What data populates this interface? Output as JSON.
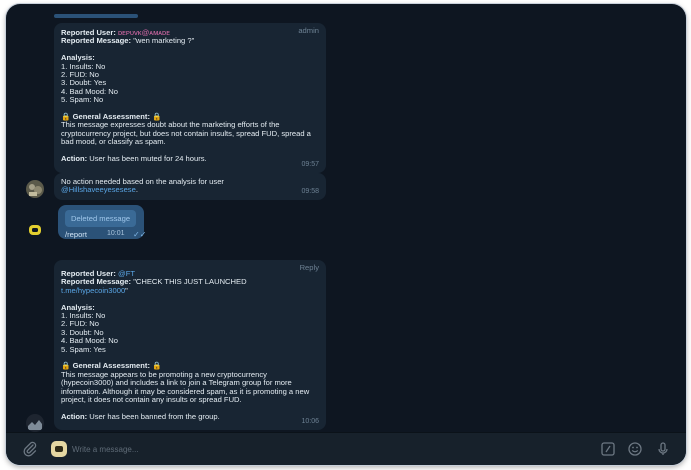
{
  "colors": {
    "background": "#0e1621",
    "bubble_in": "#182533",
    "bubble_out": "#2b5278",
    "link": "#5aa6e6",
    "time": "#6d8193"
  },
  "messages": {
    "m1": {
      "role": "admin",
      "reported_user_label": "Reported User:",
      "reported_user_value": "ᴅᴇᴩᴜᴠᴋ@ᴀᴍᴀᴅᴇ",
      "reported_message_label": "Reported Message:",
      "reported_message_value": "\"wen marketing ?\"",
      "analysis_label": "Analysis:",
      "analysis": [
        "1. Insults: No",
        "2. FUD: No",
        "3. Doubt: Yes",
        "4. Bad Mood: No",
        "5. Spam: No"
      ],
      "assessment_title": "General Assessment:",
      "assessment_text": "This message expresses doubt about the marketing efforts of the cryptocurrency project, but does not contain insults, spread FUD, spread a bad mood, or classify as spam.",
      "action_label": "Action:",
      "action_text": "User has been muted for 24 hours.",
      "time": "09:57"
    },
    "m2": {
      "text": "No action needed based on the analysis for user",
      "mention": "@Hillshaveeyesesese",
      "suffix": ".",
      "time": "09:58"
    },
    "m3": {
      "deleted_label": "Deleted message",
      "command": "/report",
      "time": "10:01",
      "check_icon": "double-check-icon"
    },
    "m4": {
      "role": "Reply",
      "reported_user_label": "Reported User:",
      "reported_user_value": "@FT",
      "reported_message_label": "Reported Message:",
      "reported_message_value": "\"CHECK THIS JUST LAUNCHED",
      "reported_message_link": "t.me/hypecoin3000",
      "reported_message_end": "\"",
      "analysis_label": "Analysis:",
      "analysis": [
        "1. Insults: No",
        "2. FUD: No",
        "3. Doubt: No",
        "4. Bad Mood: No",
        "5. Spam: Yes"
      ],
      "assessment_title": "General Assessment:",
      "assessment_text": "This message appears to be promoting a new cryptocurrency (hypecoin3000) and includes a link to join a Telegram group for more information. Although it may be considered spam, as it is promoting a new project, it does not contain any insults or spread FUD.",
      "action_label": "Action:",
      "action_text": "User has been banned from the group.",
      "time": "10:06"
    }
  },
  "composer": {
    "placeholder": "Write a message...",
    "attach_icon": "paperclip-icon",
    "commands_icon": "bot-commands-icon",
    "emoji_icon": "emoji-icon",
    "mic_icon": "microphone-icon"
  }
}
